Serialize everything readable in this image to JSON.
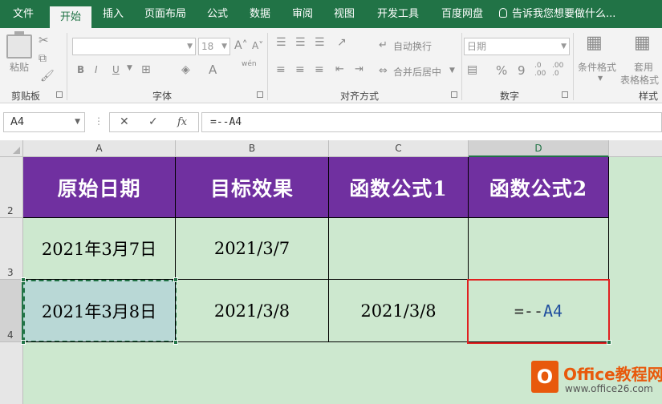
{
  "tabs": [
    "文件",
    "开始",
    "插入",
    "页面布局",
    "公式",
    "数据",
    "审阅",
    "视图",
    "开发工具",
    "百度网盘"
  ],
  "active_tab": "开始",
  "tell_me": "告诉我您想要做什么...",
  "ribbon": {
    "clipboard": {
      "paste": "粘贴",
      "label": "剪贴板"
    },
    "font": {
      "font_name": "",
      "font_size": "18",
      "bold": "B",
      "italic": "I",
      "underline": "U",
      "font_color_glyph": "A",
      "wen": "wén",
      "label": "字体"
    },
    "alignment": {
      "wrap_text": "自动换行",
      "merge_center": "合并后居中",
      "label": "对齐方式"
    },
    "number": {
      "format": "日期",
      "percent": "%",
      "comma": "9",
      "label": "数字"
    },
    "styles": {
      "conditional_format": "条件格式",
      "table_format_1": "套用",
      "table_format_2": "表格格式",
      "label": "样式"
    }
  },
  "formula_bar": {
    "name_box": "A4",
    "cancel": "✕",
    "enter": "✓",
    "fx": "fx",
    "formula": "=--A4"
  },
  "columns": [
    "A",
    "B",
    "C",
    "D"
  ],
  "rows": [
    "2",
    "3",
    "4"
  ],
  "table": {
    "headers": [
      "原始日期",
      "目标效果",
      "函数公式1",
      "函数公式2"
    ],
    "row3": [
      "2021年3月7日",
      "2021/3/7",
      "",
      ""
    ],
    "row4": [
      "2021年3月8日",
      "2021/3/8",
      "2021/3/8",
      ""
    ]
  },
  "d4_formula": {
    "eq": "=--",
    "ref": "A4"
  },
  "watermark": {
    "logo": "O",
    "title": "Office教程网",
    "url": "www.office26.com"
  },
  "colors": {
    "excel_green": "#217346",
    "header_purple": "#7030a0",
    "cell_green": "#cde8cf",
    "highlight_red": "#e02020"
  }
}
